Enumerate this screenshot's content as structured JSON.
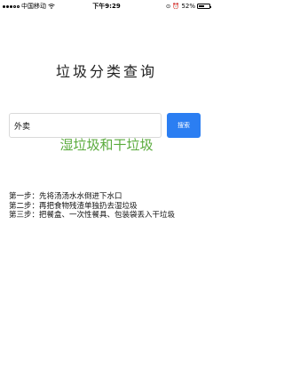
{
  "status_bar": {
    "carrier": "中国移动",
    "time": "下午9:29",
    "battery_percent_text": "52%",
    "battery_level": 0.52,
    "icons": [
      "signal-icon",
      "wifi-icon",
      "lock-rotation-icon",
      "alarm-icon",
      "battery-icon"
    ]
  },
  "page": {
    "title": "垃圾分类查询"
  },
  "search": {
    "value": "外卖",
    "button_label": "搜索"
  },
  "result": {
    "category": "湿垃圾和干垃圾",
    "category_color": "#5bab3d",
    "steps": [
      "第一步：先将汤汤水水倒进下水口",
      "第二步：再把食物残渣单独扔去湿垃圾",
      "第三步：把餐盒、一次性餐具、包装袋丢入干垃圾"
    ]
  },
  "colors": {
    "accent": "#2b7ef2"
  }
}
